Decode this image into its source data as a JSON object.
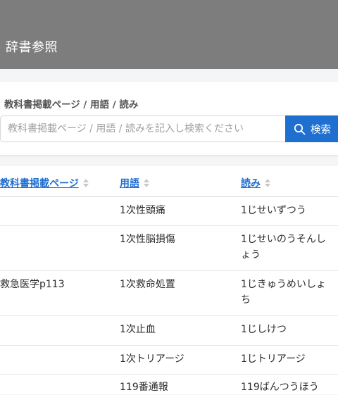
{
  "header": {
    "title": "辞書参照"
  },
  "search": {
    "label": "教科書掲載ページ / 用語 / 読み",
    "placeholder": "教科書掲載ページ / 用語 / 読みを記入し検索ください",
    "value": "",
    "button_label": "検索"
  },
  "table": {
    "columns": [
      "教科書掲載ページ",
      "用語",
      "読み"
    ],
    "rows": [
      {
        "page": "",
        "term": "1次性頭痛",
        "reading": "1じせいずつう"
      },
      {
        "page": "",
        "term": "1次性脳損傷",
        "reading_line1": "1じせいのうそんし",
        "reading_line2": "ょう"
      },
      {
        "page": "救急医学p113",
        "term": "1次救命処置",
        "reading_line1": "1じきゅうめいしょ",
        "reading_line2": "ち"
      },
      {
        "page": "",
        "term": "1次止血",
        "reading": "1じしけつ"
      },
      {
        "page": "",
        "term": "1次トリアージ",
        "reading": "1じトリアージ"
      },
      {
        "page": "",
        "term": "119番通報",
        "reading": "119ばんつうほう"
      }
    ]
  },
  "colors": {
    "header_bg": "#7d7d7d",
    "accent": "#1f6fd1",
    "page_bg": "#f4f5f7"
  }
}
